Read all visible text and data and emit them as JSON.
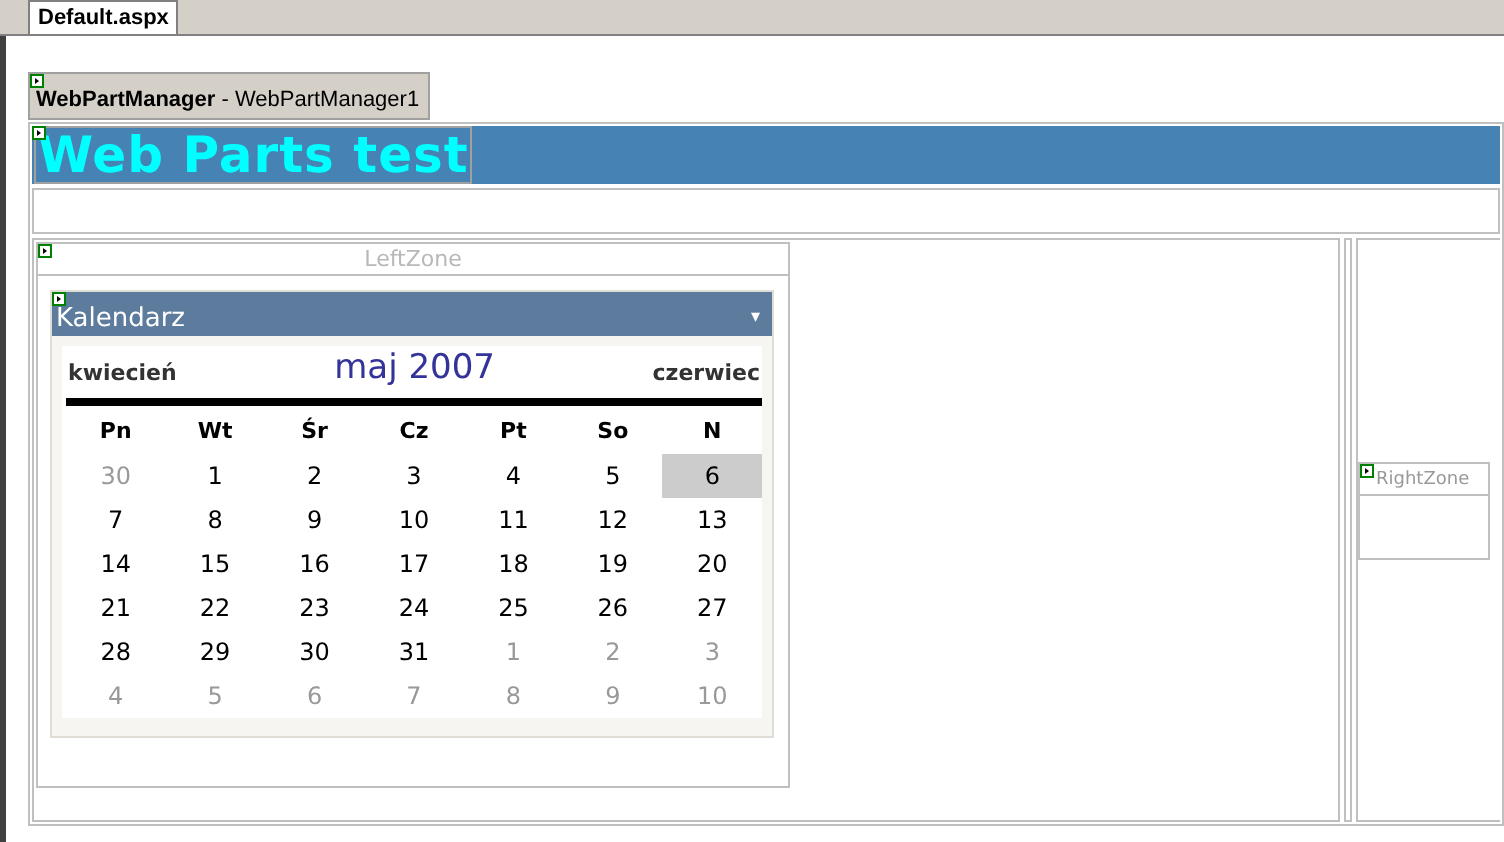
{
  "document_tab": {
    "label": "Default.aspx",
    "selected": true
  },
  "manager": {
    "type": "WebPartManager",
    "separator": "-",
    "id": "WebPartManager1"
  },
  "header": {
    "title": "Web Parts test"
  },
  "left_zone": {
    "title": "LeftZone",
    "web_part": {
      "title": "Kalendarz",
      "menu_glyph": "▾",
      "calendar": {
        "prev": "kwiecień",
        "month": "maj 2007",
        "next": "czerwiec",
        "day_names": [
          "Pn",
          "Wt",
          "Śr",
          "Cz",
          "Pt",
          "So",
          "N"
        ],
        "weeks": [
          [
            {
              "text": "30",
              "other_month": true,
              "selected": false
            },
            {
              "text": "1",
              "other_month": false,
              "selected": false
            },
            {
              "text": "2",
              "other_month": false,
              "selected": false
            },
            {
              "text": "3",
              "other_month": false,
              "selected": false
            },
            {
              "text": "4",
              "other_month": false,
              "selected": false
            },
            {
              "text": "5",
              "other_month": false,
              "selected": false
            },
            {
              "text": "6",
              "other_month": false,
              "selected": true
            }
          ],
          [
            {
              "text": "7",
              "other_month": false,
              "selected": false
            },
            {
              "text": "8",
              "other_month": false,
              "selected": false
            },
            {
              "text": "9",
              "other_month": false,
              "selected": false
            },
            {
              "text": "10",
              "other_month": false,
              "selected": false
            },
            {
              "text": "11",
              "other_month": false,
              "selected": false
            },
            {
              "text": "12",
              "other_month": false,
              "selected": false
            },
            {
              "text": "13",
              "other_month": false,
              "selected": false
            }
          ],
          [
            {
              "text": "14",
              "other_month": false,
              "selected": false
            },
            {
              "text": "15",
              "other_month": false,
              "selected": false
            },
            {
              "text": "16",
              "other_month": false,
              "selected": false
            },
            {
              "text": "17",
              "other_month": false,
              "selected": false
            },
            {
              "text": "18",
              "other_month": false,
              "selected": false
            },
            {
              "text": "19",
              "other_month": false,
              "selected": false
            },
            {
              "text": "20",
              "other_month": false,
              "selected": false
            }
          ],
          [
            {
              "text": "21",
              "other_month": false,
              "selected": false
            },
            {
              "text": "22",
              "other_month": false,
              "selected": false
            },
            {
              "text": "23",
              "other_month": false,
              "selected": false
            },
            {
              "text": "24",
              "other_month": false,
              "selected": false
            },
            {
              "text": "25",
              "other_month": false,
              "selected": false
            },
            {
              "text": "26",
              "other_month": false,
              "selected": false
            },
            {
              "text": "27",
              "other_month": false,
              "selected": false
            }
          ],
          [
            {
              "text": "28",
              "other_month": false,
              "selected": false
            },
            {
              "text": "29",
              "other_month": false,
              "selected": false
            },
            {
              "text": "30",
              "other_month": false,
              "selected": false
            },
            {
              "text": "31",
              "other_month": false,
              "selected": false
            },
            {
              "text": "1",
              "other_month": true,
              "selected": false
            },
            {
              "text": "2",
              "other_month": true,
              "selected": false
            },
            {
              "text": "3",
              "other_month": true,
              "selected": false
            }
          ],
          [
            {
              "text": "4",
              "other_month": true,
              "selected": false
            },
            {
              "text": "5",
              "other_month": true,
              "selected": false
            },
            {
              "text": "6",
              "other_month": true,
              "selected": false
            },
            {
              "text": "7",
              "other_month": true,
              "selected": false
            },
            {
              "text": "8",
              "other_month": true,
              "selected": false
            },
            {
              "text": "9",
              "other_month": true,
              "selected": false
            },
            {
              "text": "10",
              "other_month": true,
              "selected": false
            }
          ]
        ]
      }
    }
  },
  "right_zone": {
    "title": "RightZone"
  }
}
